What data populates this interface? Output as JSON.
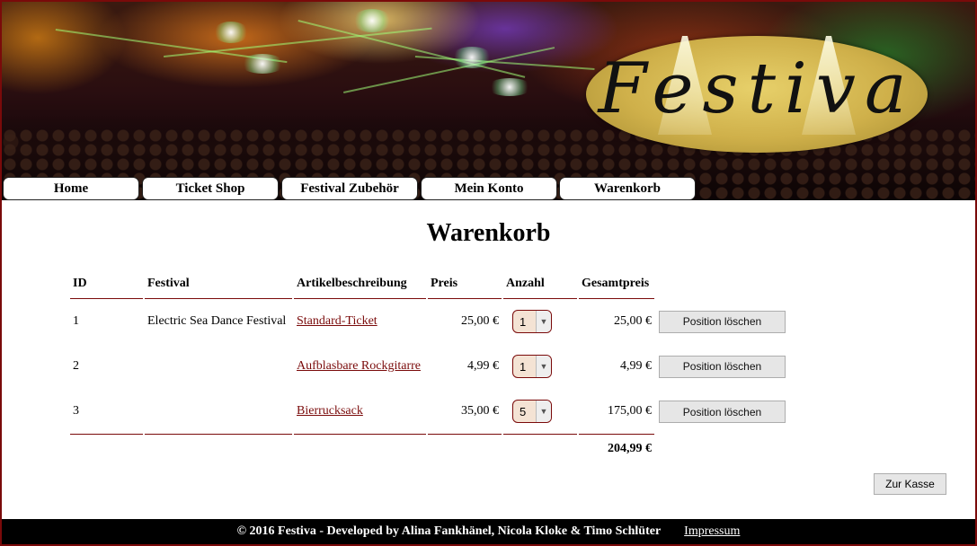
{
  "header": {
    "logo_text": "Festiva"
  },
  "nav": {
    "items": [
      {
        "label": "Home"
      },
      {
        "label": "Ticket Shop"
      },
      {
        "label": "Festival Zubehör"
      },
      {
        "label": "Mein Konto"
      },
      {
        "label": "Warenkorb"
      }
    ]
  },
  "main": {
    "title": "Warenkorb",
    "columns": [
      "ID",
      "Festival",
      "Artikelbeschreibung",
      "Preis",
      "Anzahl",
      "Gesamtpreis"
    ],
    "rows": [
      {
        "id": "1",
        "festival": "Electric Sea Dance Festival",
        "article": "Standard-Ticket",
        "price": "25,00 €",
        "qty": "1",
        "total": "25,00 €",
        "delete_label": "Position löschen"
      },
      {
        "id": "2",
        "festival": "",
        "article": "Aufblasbare Rockgitarre",
        "price": "4,99 €",
        "qty": "1",
        "total": "4,99 €",
        "delete_label": "Position löschen"
      },
      {
        "id": "3",
        "festival": "",
        "article": "Bierrucksack",
        "price": "35,00 €",
        "qty": "5",
        "total": "175,00 €",
        "delete_label": "Position löschen"
      }
    ],
    "grand_total": "204,99 €",
    "checkout_label": "Zur Kasse"
  },
  "footer": {
    "copyright": "© 2016 Festiva - Developed by Alina Fankhänel, Nicola Kloke & Timo Schlüter",
    "impressum": "Impressum"
  },
  "colors": {
    "accent": "#7a0a0a",
    "qty_bg": "#f4e3d4"
  }
}
